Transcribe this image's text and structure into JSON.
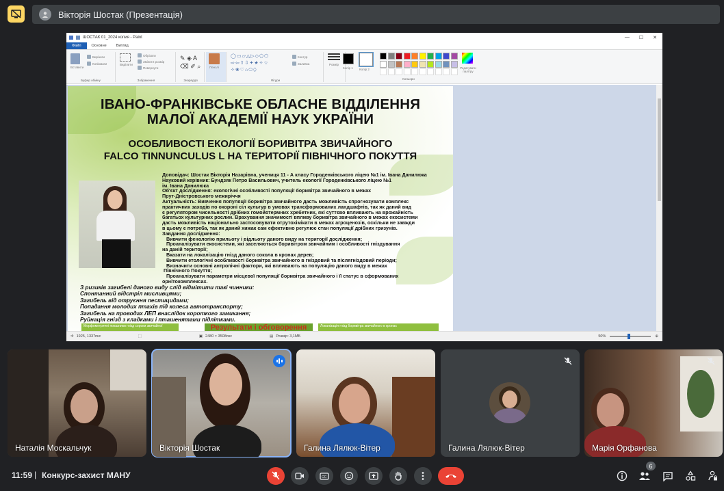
{
  "header": {
    "title": "Вікторія Шостак (Презентація)"
  },
  "paint": {
    "window_title": "ШОСТАК 01_2024 копия - Paint",
    "tabs": [
      "Файл",
      "Основне",
      "Вигляд"
    ],
    "ribbon": {
      "paste_label": "Вставити",
      "cut_label": "Вирізати",
      "copy_label": "Копіювати",
      "clipboard_group": "Буфер обміну",
      "select_label": "Виділити",
      "crop_label": "Обрізати",
      "resize_label": "Змінити розмір",
      "rotate_label": "Повернути",
      "image_group": "Зображення",
      "tools_group": "Знаряддя",
      "brushes_label": "Пензлі",
      "shapes_group": "Фігури",
      "outline_label": "Контур",
      "fill_label": "Заливка",
      "size_label": "Розмір",
      "color1_label": "Колір 1",
      "color2_label": "Колір 2",
      "edit_colors_label": "Редагувати палітру",
      "colors_group": "Кольори"
    },
    "palette": [
      "#000000",
      "#7f7f7f",
      "#880015",
      "#ed1c24",
      "#ff7f27",
      "#fff200",
      "#22b14c",
      "#00a2e8",
      "#3f48cc",
      "#a349a4",
      "#ffffff",
      "#c3c3c3",
      "#b97a57",
      "#ffaec9",
      "#ffc90e",
      "#efe4b0",
      "#b5e61d",
      "#99d9ea",
      "#7092be",
      "#c8bfe7"
    ],
    "status": {
      "cursor": "1925, 1337пкс",
      "dimensions": "2480 × 3508пкс",
      "filesize": "Розмір: 3,1МБ",
      "zoom": "50%"
    },
    "slide": {
      "title_line1": "ІВАНО-ФРАНКІВСЬКЕ ОБЛАСНЕ ВІДДІЛЕННЯ",
      "title_line2": "МАЛОЇ АКАДЕМІЇ НАУК УКРАЇНИ",
      "subtitle_line1": "ОСОБЛИВОСТІ ЕКОЛОГІЇ БОРИВІТРА ЗВИЧАЙНОГО",
      "subtitle_line2": "FALCO TINNUNCULUS L НА ТЕРИТОРІЇ ПІВНІЧНОГО ПОКУТТЯ",
      "body": "Доповідач: Шостак Вікторія Назарівна, учениця 11 - А класу Городенківського ліцею №1 ім. Івана Данилюка\nНауковий керівник: Бундзяк Петро Васильович, учитель екології Городенківського ліцею №1\nім. Івана Данилюка\nОб'єкт дослідження: екологічні особливості популяції боривітра звичайного в межах\nПрут-Дністровського межиріччя\nАктуальність: Вивчення популяції боривітра звичайного дасть можливість спрогнозувати комплекс\nпрактичних заходів по охороні сіл культур в умовах трансформованих ландшафтів, так як даний вид\nє регулятором чисельності дрібних гомойотермних хребетних, які суттєво впливають на врожайність\nбагатьох культурних рослин. Врахування значимості впливу боривітра звичайного в межах екосистеми\nдасть можливість національно застосовувати отрутохімікати в межах агроценозів, оскільки не завжди\nв цьому є потреба, так як даний хижак сам ефективно регулює стан популяції дрібних гризунів.\nЗавдання дослідження:\n   Вивчити фенологію прильоту і відльоту даного виду на території дослідження;\n   Проаналізувати екосистеми, які заселяються боривітром звичайним і особливості гніздування\nна даній території;\n   Вказати на локалізацію гнізд даного сокола в кронах дерев;\n   Вивчити етологічні особливості боривітра звичайного в гніздовий та післягніздовий періоди;\n   Визначити основні антропічні фактори, які впливають на популяцію даного виду в межах\n Північного Покуття;\n   Проаналізувати параметри місцевої популяції боривітра звичайного і її статус в сформованих\nорнітокомплексах.",
      "risks": "З ризиків загибелі даного виду слід відмітити такі чинники:\nСпонтанний відстріл мисливцями;\nЗагибель від отруєння пестицидами;\nПопадання молодих птахів під колеса автотранспорту;\nЗагибель на проводах ЛЕП внаслідок короткого замикання;\nРуйнація гнізд з кладками і пташенятами підлітками.",
      "bottom_left": "Морфометричні показники гнізд сороки звичайної",
      "bottom_center": "Результати і обговорення",
      "bottom_right": "Локалізація гнізд боривітра звичайного в кронах"
    }
  },
  "participants": [
    {
      "name": "Наталія Москальчук",
      "muted": false
    },
    {
      "name": "Вікторія Шостак",
      "muted": false,
      "speaking": true
    },
    {
      "name": "Галина Лялюк-Вітер",
      "muted": false
    },
    {
      "name": "Галина Лялюк-Вітер",
      "muted": true
    },
    {
      "name": "Марія Орфанова",
      "muted": true
    }
  ],
  "footer": {
    "time": "11:59",
    "separator": "|",
    "meeting_name": "Конкурс-захист МАНУ",
    "participants_count": "6"
  },
  "colors": {
    "background": "#202124",
    "hangup": "#ea4335",
    "present_icon": "#fdd663",
    "speaking": "#1a73e8"
  }
}
